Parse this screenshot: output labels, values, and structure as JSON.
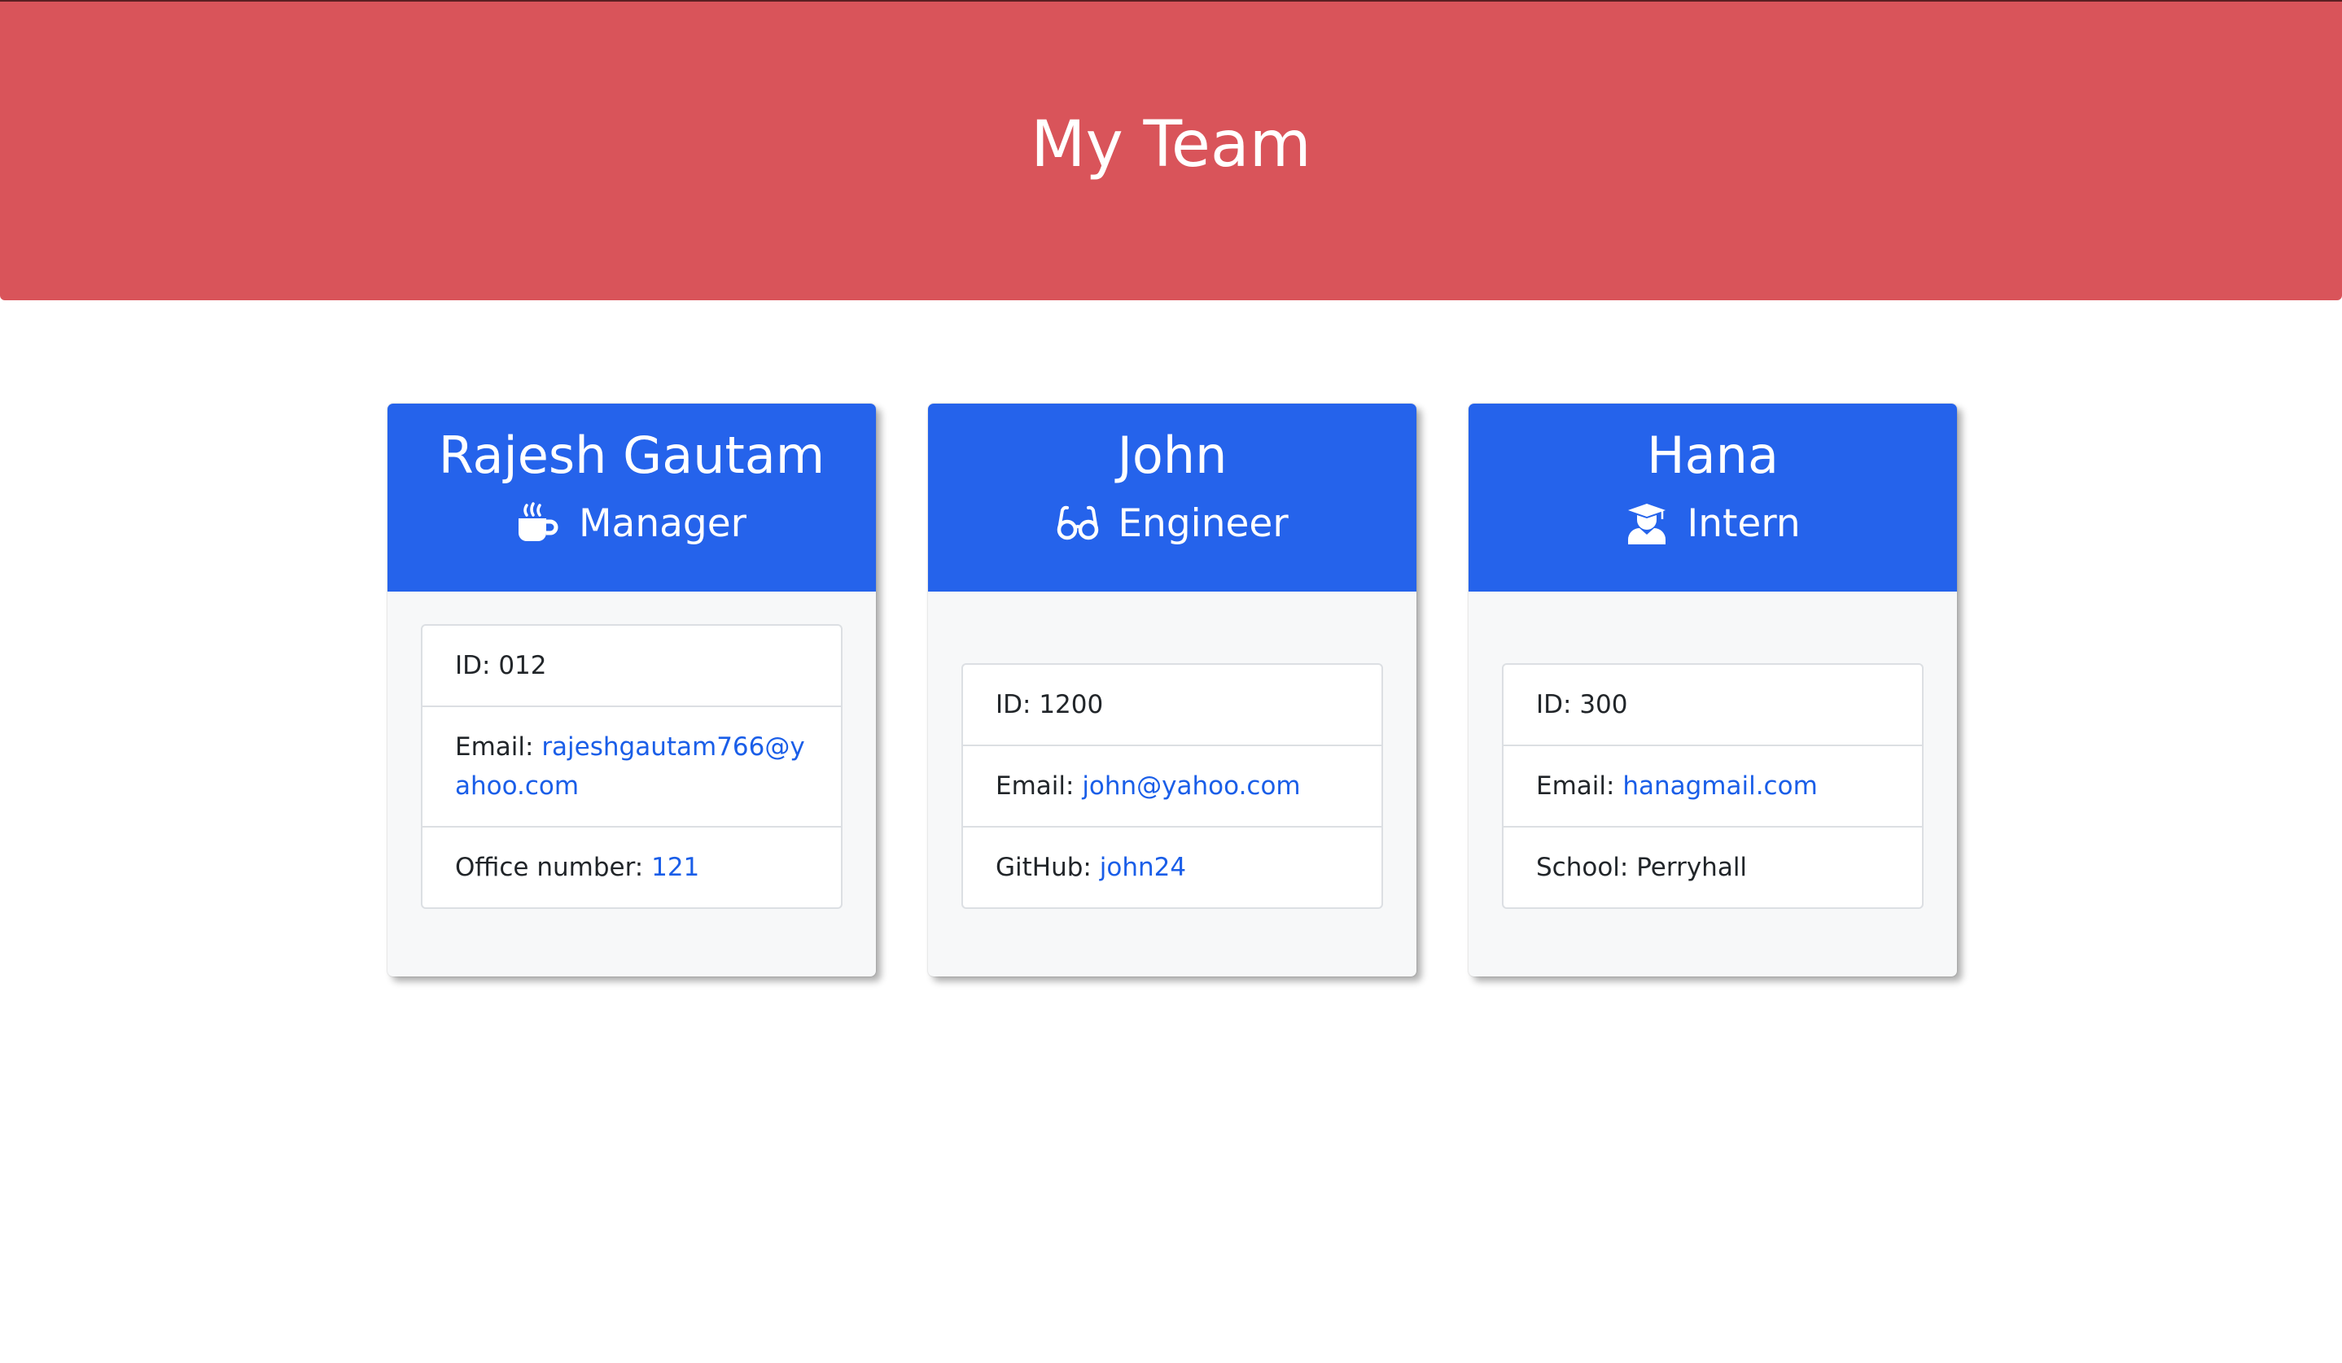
{
  "header": {
    "title": "My Team"
  },
  "theme": {
    "header_bg": "#d9545a",
    "card_header_bg": "#2563eb",
    "link_color": "#1a5ee8"
  },
  "cards": [
    {
      "name": "Rajesh Gautam",
      "role": "Manager",
      "role_icon": "coffee-mug-icon",
      "id_label": "ID:",
      "id_value": "012",
      "email_label": "Email:",
      "email_value": "rajeshgautam766@yahoo.com",
      "extra_label": "Office number:",
      "extra_value": "121"
    },
    {
      "name": "John",
      "role": "Engineer",
      "role_icon": "glasses-icon",
      "id_label": "ID:",
      "id_value": "1200",
      "email_label": "Email:",
      "email_value": "john@yahoo.com",
      "extra_label": "GitHub:",
      "extra_value": "john24"
    },
    {
      "name": "Hana",
      "role": "Intern",
      "role_icon": "graduate-icon",
      "id_label": "ID:",
      "id_value": "300",
      "email_label": "Email:",
      "email_value": "hanagmail.com",
      "extra_label": "School:",
      "extra_value": "Perryhall"
    }
  ]
}
